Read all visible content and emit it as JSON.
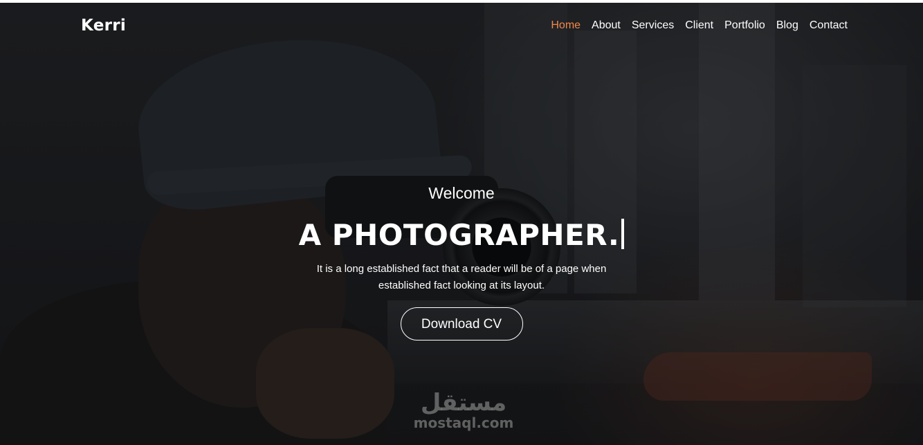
{
  "brand": {
    "logo": "Kerri"
  },
  "nav": {
    "items": [
      {
        "label": "Home",
        "active": true
      },
      {
        "label": "About",
        "active": false
      },
      {
        "label": "Services",
        "active": false
      },
      {
        "label": "Client",
        "active": false
      },
      {
        "label": "Portfolio",
        "active": false
      },
      {
        "label": "Blog",
        "active": false
      },
      {
        "label": "Contact",
        "active": false
      }
    ]
  },
  "hero": {
    "welcome": "Welcome",
    "headline": "A PHOTOGRAPHER.",
    "description": "It is a long established fact that a reader will be of a page when established fact looking at its layout.",
    "button_label": "Download CV"
  },
  "watermark": {
    "arabic": "مستقل",
    "latin": "mostaql.com"
  },
  "colors": {
    "accent": "#f3884a",
    "text": "#ffffff"
  }
}
